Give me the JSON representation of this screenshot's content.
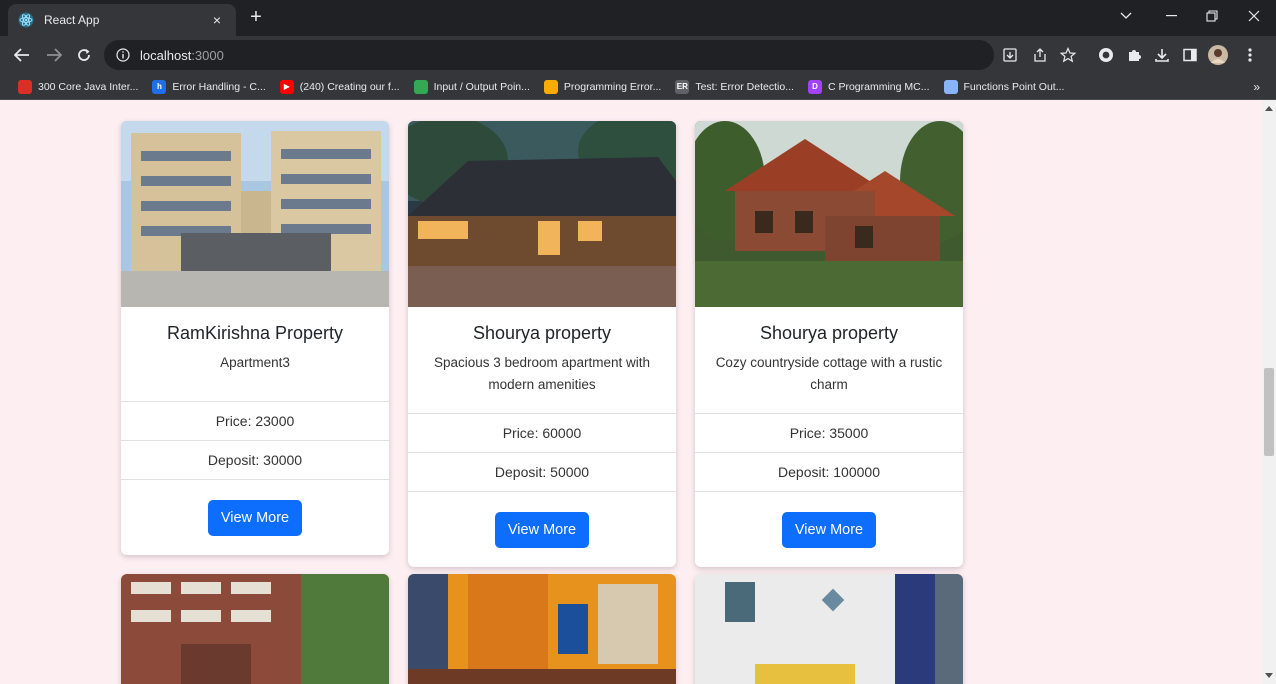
{
  "browser": {
    "tab_title": "React App",
    "tab_close": "×",
    "new_tab": "+",
    "url_host": "localhost",
    "url_port": ":3000"
  },
  "bookmarks": [
    {
      "label": "300 Core Java Inter...",
      "color": "#d93025",
      "glyph": ""
    },
    {
      "label": "Error Handling - C...",
      "color": "#1f6feb",
      "glyph": "h"
    },
    {
      "label": "(240) Creating our f...",
      "color": "#ff0000",
      "glyph": "▶"
    },
    {
      "label": "Input / Output Poin...",
      "color": "#34a853",
      "glyph": ""
    },
    {
      "label": "Programming Error...",
      "color": "#f9ab00",
      "glyph": ""
    },
    {
      "label": "Test: Error Detectio...",
      "color": "#5f6368",
      "glyph": "ER"
    },
    {
      "label": "C Programming MC...",
      "color": "#a142f4",
      "glyph": "D"
    },
    {
      "label": "Functions Point Out...",
      "color": "#8ab4f8",
      "glyph": ""
    }
  ],
  "bookmarks_more": "»",
  "properties": [
    {
      "title": "RamKirishna Property",
      "desc": "Apartment3",
      "price": "Price: 23000",
      "deposit": "Deposit: 30000",
      "button": "View More"
    },
    {
      "title": "Shourya property",
      "desc": "Spacious 3 bedroom apartment with modern amenities",
      "price": "Price: 60000",
      "deposit": "Deposit: 50000",
      "button": "View More"
    },
    {
      "title": "Shourya property",
      "desc": "Cozy countryside cottage with a rustic charm",
      "price": "Price: 35000",
      "deposit": "Deposit: 100000",
      "button": "View More"
    }
  ],
  "colors": {
    "page_bg": "#fdeef2",
    "button": "#0d6efd"
  }
}
